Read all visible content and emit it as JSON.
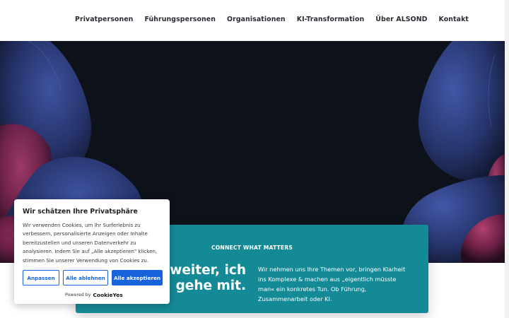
{
  "nav": {
    "items": [
      "Privatpersonen",
      "Führungspersonen",
      "Organisationen",
      "KI-Transformation",
      "Über ALSOND",
      "Kontakt"
    ]
  },
  "hero": {
    "background_color": "#0d111a",
    "blob_blue": "#2b3a6e",
    "blob_magenta": "#7a2450"
  },
  "card": {
    "color": "#158a97",
    "eyebrow": "CONNECT WHAT MATTERS",
    "headline_line1": "n weiter, ich",
    "headline_line2": "gehe mit.",
    "text": "Wir nehmen uns Ihre Themen vor, bringen Klarheit ins Komplexe & machen aus „eigentlich müsste man« ein konkretes Tun. Ob Führung, Zusammenarbeit oder KI."
  },
  "cookie": {
    "title": "Wir schätzen Ihre Privatsphäre",
    "text": "Wir verwenden Cookies, um Ihr Surferlebnis zu verbessern, personalisierte Anzeigen oder Inhalte bereitzustellen und unseren Datenverkehr zu analysieren. Indem Sie auf „Alle akzeptieren\" klicken, stimmen Sie unserer Verwendung von Cookies zu.",
    "buttons": {
      "customize": "Anpassen",
      "reject": "Alle ablehnen",
      "accept": "Alle akzeptieren"
    },
    "powered_by": "Powered by",
    "brand": "CookieYes",
    "accent": "#1863dc"
  }
}
